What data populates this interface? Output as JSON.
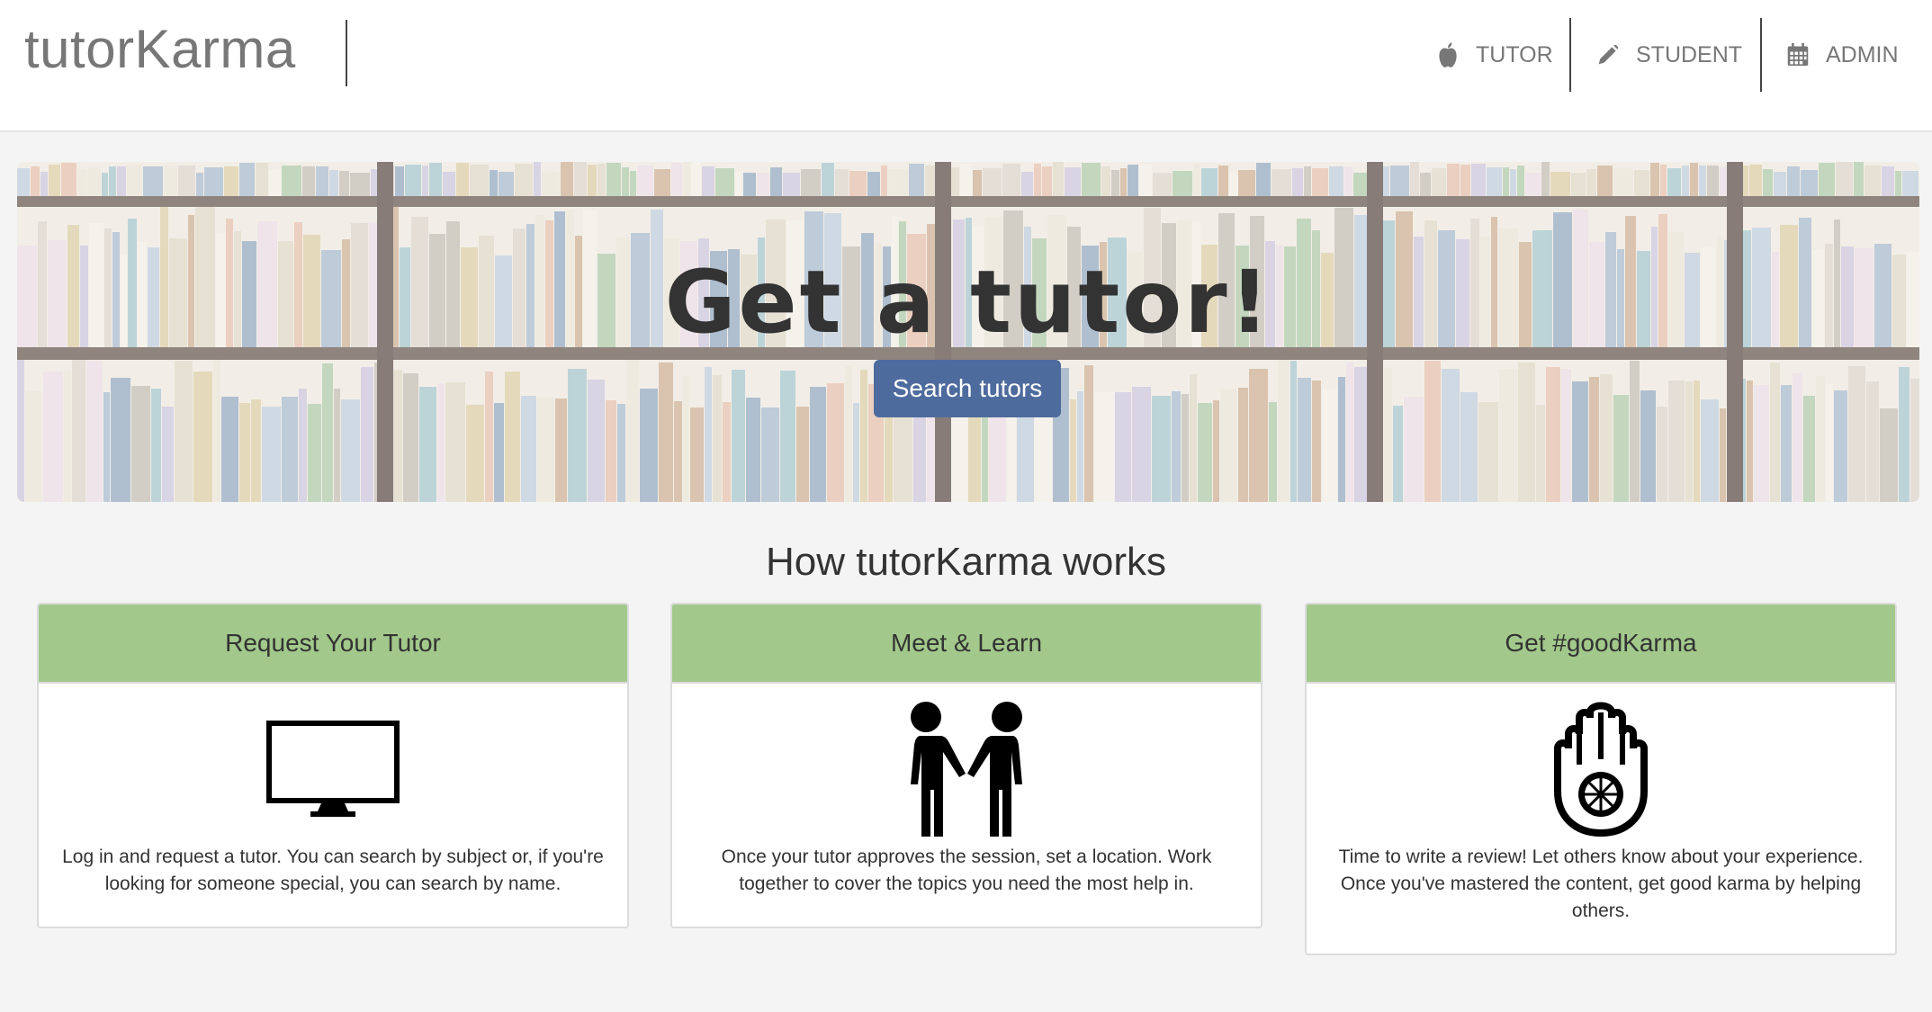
{
  "navbar": {
    "brand": "tutorKarma",
    "items": [
      {
        "label": "TUTOR",
        "icon": "apple-icon"
      },
      {
        "label": "STUDENT",
        "icon": "pencil-icon"
      },
      {
        "label": "ADMIN",
        "icon": "calendar-icon"
      }
    ]
  },
  "hero": {
    "title": "Get a tutor!",
    "button_label": "Search tutors"
  },
  "how_it_works": {
    "title": "How tutorKarma works",
    "cards": [
      {
        "title": "Request Your Tutor",
        "icon": "monitor-icon",
        "text": "Log in and request a tutor. You can search by subject or, if you're looking for someone special, you can search by name."
      },
      {
        "title": "Meet & Learn",
        "icon": "people-icon",
        "text": "Once your tutor approves the session, set a location. Work together to cover the topics you need the most help in."
      },
      {
        "title": "Get #goodKarma",
        "icon": "hand-wheel-icon",
        "text": "Time to write a review! Let others know about your experience. Once you've mastered the content, get good karma by helping others."
      }
    ]
  },
  "colors": {
    "card_header": "#a2c98b",
    "button": "#4e6b9e",
    "background": "#f4f4f4"
  }
}
